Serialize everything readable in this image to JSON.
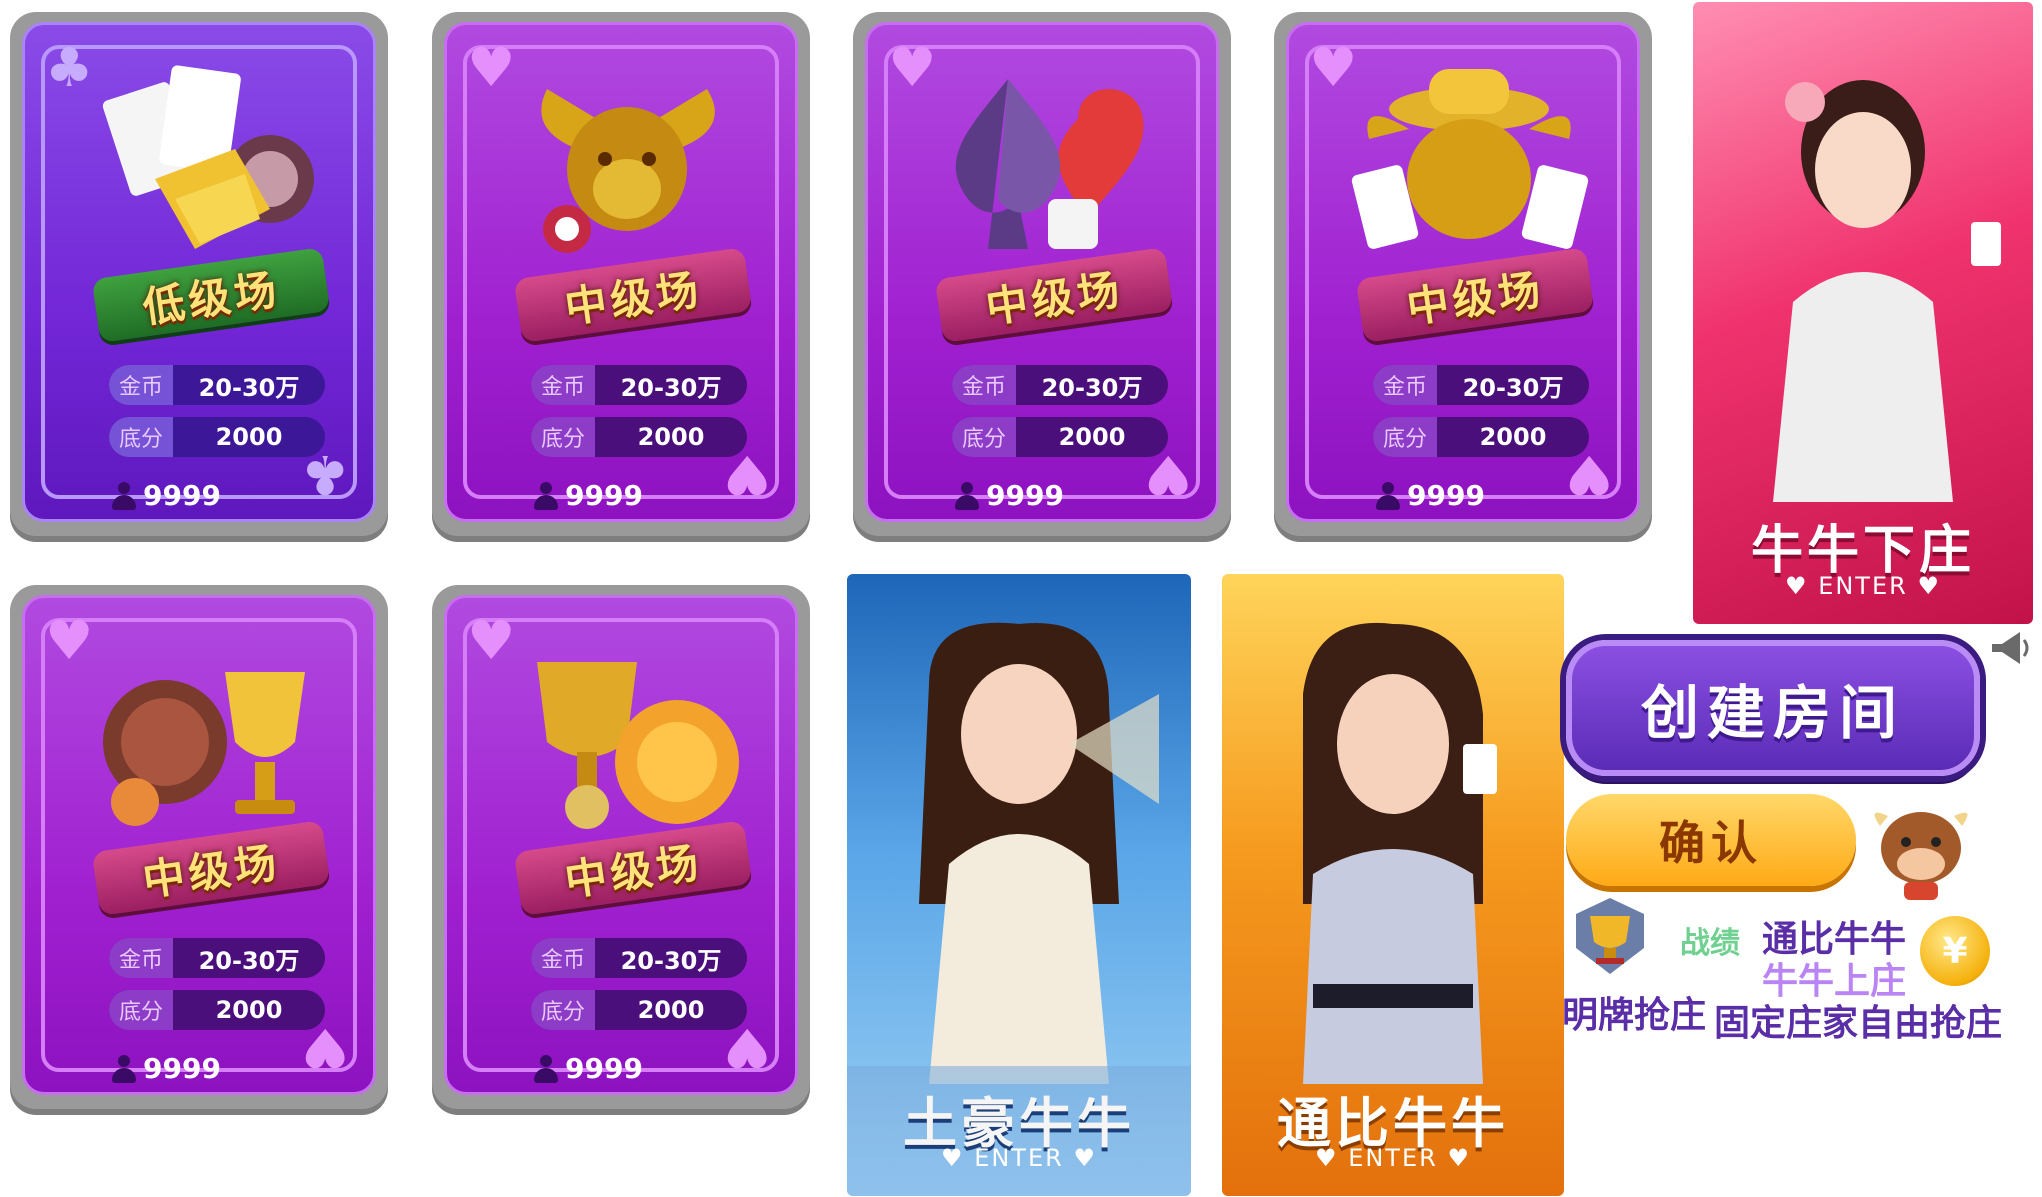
{
  "cards": [
    {
      "suit": "♣",
      "level": "低级场",
      "gold_label": "金币",
      "gold_value": "20-30万",
      "base_label": "底分",
      "base_value": "2000",
      "players": "9999"
    },
    {
      "suit": "♥",
      "level": "中级场",
      "gold_label": "金币",
      "gold_value": "20-30万",
      "base_label": "底分",
      "base_value": "2000",
      "players": "9999"
    },
    {
      "suit": "♥",
      "level": "中级场",
      "gold_label": "金币",
      "gold_value": "20-30万",
      "base_label": "底分",
      "base_value": "2000",
      "players": "9999"
    },
    {
      "suit": "♥",
      "level": "中级场",
      "gold_label": "金币",
      "gold_value": "20-30万",
      "base_label": "底分",
      "base_value": "2000",
      "players": "9999"
    },
    {
      "suit": "♥",
      "level": "中级场",
      "gold_label": "金币",
      "gold_value": "20-30万",
      "base_label": "底分",
      "base_value": "2000",
      "players": "9999"
    },
    {
      "suit": "♥",
      "level": "中级场",
      "gold_label": "金币",
      "gold_value": "20-30万",
      "base_label": "底分",
      "base_value": "2000",
      "players": "9999"
    }
  ],
  "modes": {
    "banker_down": {
      "title": "牛牛下庄",
      "enter": "ENTER"
    },
    "tuhao": {
      "title": "土豪牛牛",
      "enter": "ENTER"
    },
    "tongbi": {
      "title": "通比牛牛",
      "enter": "ENTER"
    }
  },
  "buttons": {
    "create_room": "创建房间",
    "confirm": "确认"
  },
  "labels": {
    "record": "战绩",
    "tongbi": "通比牛牛",
    "banker_up": "牛牛上庄",
    "open_grab": "明牌抢庄",
    "fixed_free": "固定庄家自由抢庄",
    "yen": "¥"
  },
  "icons": [
    "megaphone-icon",
    "trophy-icon",
    "yen-coin-icon",
    "bull-mascot-icon",
    "heart-icon",
    "club-icon",
    "person-icon"
  ],
  "colors": {
    "card_purple": "#a020d0",
    "card_low_purple": "#7226d6",
    "confirm_orange": "#ffaa16",
    "create_purple": "#5a2cb6"
  }
}
